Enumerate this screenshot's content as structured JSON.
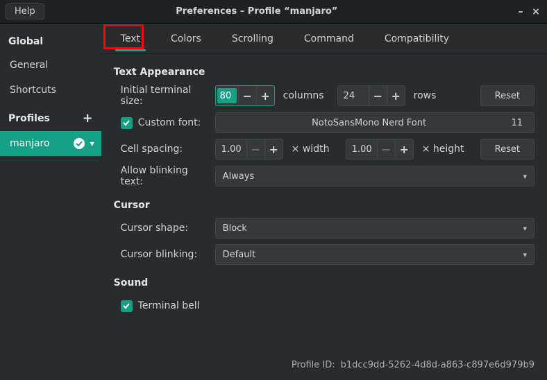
{
  "titlebar": {
    "help": "Help",
    "title": "Preferences – Profile “manjaro”"
  },
  "sidebar": {
    "global_header": "Global",
    "items": [
      {
        "label": "General"
      },
      {
        "label": "Shortcuts"
      }
    ],
    "profiles_header": "Profiles",
    "profile_items": [
      {
        "label": "manjaro",
        "active": true
      }
    ]
  },
  "tabs": {
    "items": [
      "Text",
      "Colors",
      "Scrolling",
      "Command",
      "Compatibility"
    ],
    "active_index": 0
  },
  "panel": {
    "text_appearance": {
      "heading": "Text Appearance",
      "initial_size_label": "Initial terminal size:",
      "columns_value": "80",
      "columns_label": "columns",
      "rows_value": "24",
      "rows_label": "rows",
      "reset_label": "Reset",
      "custom_font_label": "Custom font:",
      "font_name": "NotoSansMono Nerd Font",
      "font_size": "11",
      "cell_spacing_label": "Cell spacing:",
      "width_value": "1.00",
      "width_label": "× width",
      "height_value": "1.00",
      "height_label": "× height",
      "allow_blinking_label": "Allow blinking text:",
      "allow_blinking_value": "Always"
    },
    "cursor": {
      "heading": "Cursor",
      "shape_label": "Cursor shape:",
      "shape_value": "Block",
      "blinking_label": "Cursor blinking:",
      "blinking_value": "Default"
    },
    "sound": {
      "heading": "Sound",
      "terminal_bell_label": "Terminal bell"
    }
  },
  "footer": {
    "profile_id_label": "Profile ID:",
    "profile_id_value": "b1dcc9dd-5262-4d8d-a863-c897e6d979b9"
  }
}
